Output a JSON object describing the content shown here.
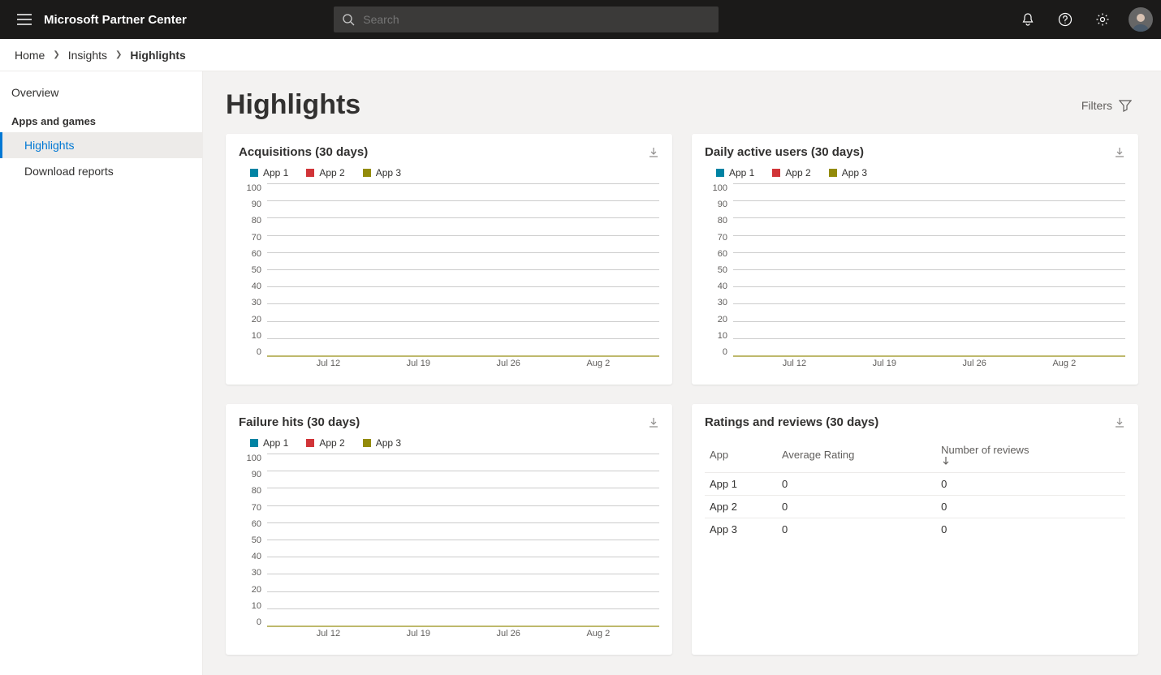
{
  "brand": "Microsoft Partner Center",
  "search": {
    "placeholder": "Search"
  },
  "breadcrumb": {
    "home": "Home",
    "insights": "Insights",
    "current": "Highlights"
  },
  "sidebar": {
    "overview": "Overview",
    "section": "Apps and games",
    "highlights": "Highlights",
    "download_reports": "Download reports"
  },
  "page": {
    "title": "Highlights",
    "filters": "Filters"
  },
  "legend_series": {
    "s1": "App 1",
    "s2": "App 2",
    "s3": "App 3"
  },
  "series_colors": {
    "s1": "#0083a3",
    "s2": "#d13438",
    "s3": "#938b0a"
  },
  "y_ticks": [
    "100",
    "90",
    "80",
    "70",
    "60",
    "50",
    "40",
    "30",
    "20",
    "10",
    "0"
  ],
  "x_ticks": [
    "Jul 12",
    "Jul 19",
    "Jul 26",
    "Aug 2"
  ],
  "cards": {
    "acq": {
      "title": "Acquisitions (30 days)"
    },
    "dau": {
      "title": "Daily active users (30 days)"
    },
    "fail": {
      "title": "Failure hits (30 days)"
    },
    "ratings": {
      "title": "Ratings and reviews (30 days)",
      "cols": {
        "app": "App",
        "avg": "Average Rating",
        "num": "Number of reviews"
      },
      "rows": [
        {
          "app": "App 1",
          "avg": "0",
          "num": "0"
        },
        {
          "app": "App 2",
          "avg": "0",
          "num": "0"
        },
        {
          "app": "App 3",
          "avg": "0",
          "num": "0"
        }
      ]
    }
  },
  "chart_data": [
    {
      "type": "line",
      "title": "Acquisitions (30 days)",
      "xlabel": "",
      "ylabel": "",
      "x_ticks": [
        "Jul 12",
        "Jul 19",
        "Jul 26",
        "Aug 2"
      ],
      "ylim": [
        0,
        100
      ],
      "series": [
        {
          "name": "App 1",
          "values": [
            0,
            0,
            0,
            0
          ]
        },
        {
          "name": "App 2",
          "values": [
            0,
            0,
            0,
            0
          ]
        },
        {
          "name": "App 3",
          "values": [
            0,
            0,
            0,
            0
          ]
        }
      ]
    },
    {
      "type": "line",
      "title": "Daily active users (30 days)",
      "xlabel": "",
      "ylabel": "",
      "x_ticks": [
        "Jul 12",
        "Jul 19",
        "Jul 26",
        "Aug 2"
      ],
      "ylim": [
        0,
        100
      ],
      "series": [
        {
          "name": "App 1",
          "values": [
            0,
            0,
            0,
            0
          ]
        },
        {
          "name": "App 2",
          "values": [
            0,
            0,
            0,
            0
          ]
        },
        {
          "name": "App 3",
          "values": [
            0,
            0,
            0,
            0
          ]
        }
      ]
    },
    {
      "type": "line",
      "title": "Failure hits (30 days)",
      "xlabel": "",
      "ylabel": "",
      "x_ticks": [
        "Jul 12",
        "Jul 19",
        "Jul 26",
        "Aug 2"
      ],
      "ylim": [
        0,
        100
      ],
      "series": [
        {
          "name": "App 1",
          "values": [
            0,
            0,
            0,
            0
          ]
        },
        {
          "name": "App 2",
          "values": [
            0,
            0,
            0,
            0
          ]
        },
        {
          "name": "App 3",
          "values": [
            0,
            0,
            0,
            0
          ]
        }
      ]
    },
    {
      "type": "table",
      "title": "Ratings and reviews (30 days)",
      "columns": [
        "App",
        "Average Rating",
        "Number of reviews"
      ],
      "rows": [
        [
          "App 1",
          0,
          0
        ],
        [
          "App 2",
          0,
          0
        ],
        [
          "App 3",
          0,
          0
        ]
      ]
    }
  ]
}
